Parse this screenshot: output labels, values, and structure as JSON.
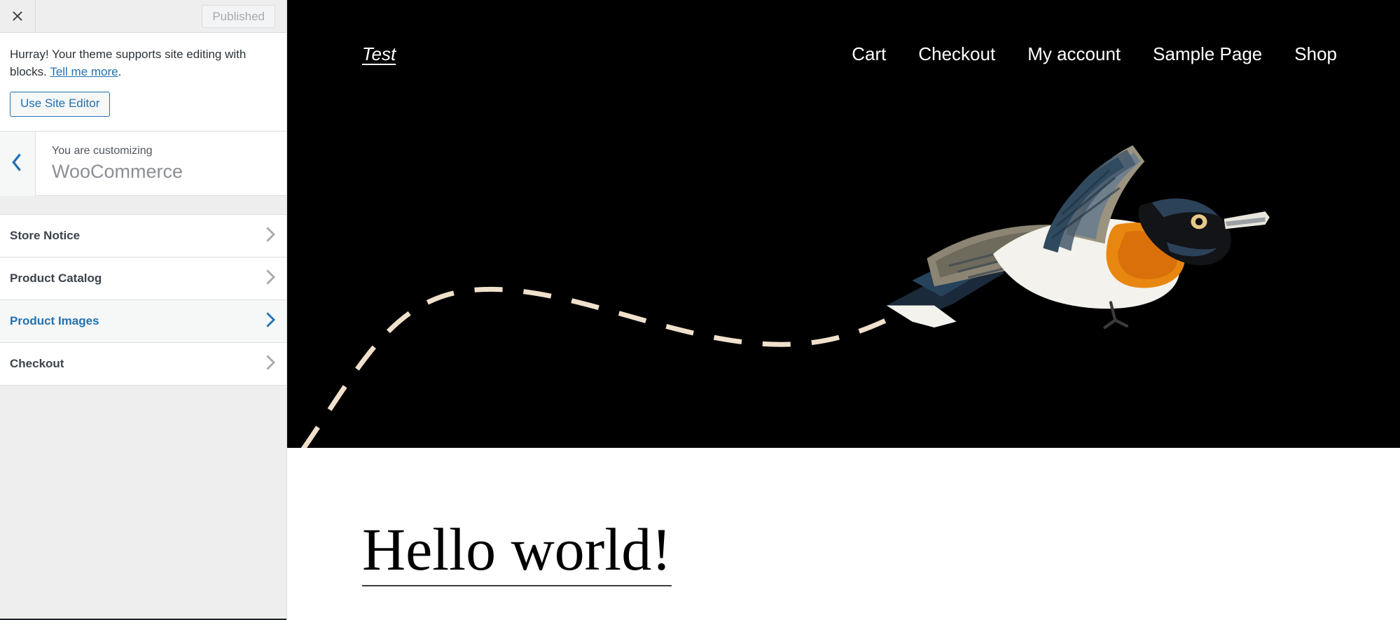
{
  "sidebar": {
    "close_icon": "close-icon",
    "publish_button": {
      "label": "Published",
      "state": "disabled"
    },
    "notice": {
      "text_before_link": "Hurray! Your theme supports site editing with blocks. ",
      "link_label": "Tell me more",
      "text_after_link": ".",
      "button_label": "Use Site Editor"
    },
    "panel": {
      "back_icon": "chevron-left-icon",
      "eyebrow": "You are customizing",
      "title": "WooCommerce"
    },
    "sections": [
      {
        "label": "Store Notice",
        "icon": "chevron-right-icon",
        "active": false
      },
      {
        "label": "Product Catalog",
        "icon": "chevron-right-icon",
        "active": false
      },
      {
        "label": "Product Images",
        "icon": "chevron-right-icon",
        "active": true
      },
      {
        "label": "Checkout",
        "icon": "chevron-right-icon",
        "active": false
      }
    ]
  },
  "preview": {
    "site_title": "Test",
    "nav": [
      {
        "label": "Cart"
      },
      {
        "label": "Checkout"
      },
      {
        "label": "My account"
      },
      {
        "label": "Sample Page"
      },
      {
        "label": "Shop"
      }
    ],
    "hero": {
      "background_color": "#000000",
      "illustration": "flying-bird-illustration",
      "trail": "dashed-flight-path"
    },
    "post_title": "Hello world!"
  },
  "colors": {
    "accent_blue": "#2271b1",
    "sidebar_bg": "#eeeeee",
    "panel_bg": "#ffffff",
    "active_row_bg": "#f6f7f7",
    "hero_black": "#000000",
    "trail_cream": "#f0e0cc",
    "bird_orange": "#e8870f",
    "bird_dark": "#14171c",
    "bird_blue": "#2d4a63",
    "bird_white": "#f2efe9"
  }
}
